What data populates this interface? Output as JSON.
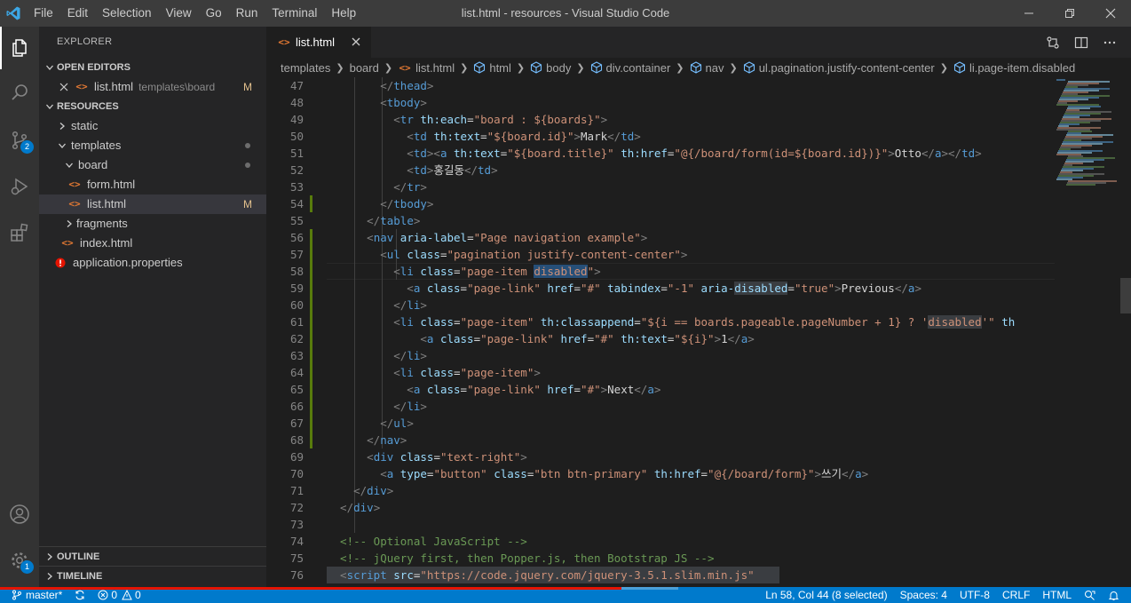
{
  "window": {
    "title": "list.html - resources - Visual Studio Code"
  },
  "menu": [
    "File",
    "Edit",
    "Selection",
    "View",
    "Go",
    "Run",
    "Terminal",
    "Help"
  ],
  "activity_bar": {
    "source_control_badge": "2",
    "settings_badge": "1"
  },
  "sidebar": {
    "title": "EXPLORER",
    "open_editors": {
      "header": "OPEN EDITORS",
      "items": [
        {
          "name": "list.html",
          "description": "templates\\board",
          "status": "M"
        }
      ]
    },
    "resources": {
      "header": "RESOURCES",
      "tree": [
        {
          "name": "static",
          "kind": "folder",
          "expanded": false
        },
        {
          "name": "templates",
          "kind": "folder",
          "expanded": true
        },
        {
          "name": "board",
          "kind": "folder",
          "expanded": true
        },
        {
          "name": "form.html",
          "kind": "html"
        },
        {
          "name": "list.html",
          "kind": "html",
          "status": "M"
        },
        {
          "name": "fragments",
          "kind": "folder",
          "expanded": false
        },
        {
          "name": "index.html",
          "kind": "html"
        },
        {
          "name": "application.properties",
          "kind": "properties"
        }
      ]
    },
    "outline": "OUTLINE",
    "timeline": "TIMELINE"
  },
  "tab": {
    "label": "list.html"
  },
  "breadcrumb": [
    "templates",
    "board",
    "list.html",
    "html",
    "body",
    "div.container",
    "nav",
    "ul.pagination.justify-content-center",
    "li.page-item.disabled"
  ],
  "code": {
    "line_numbers": [
      "47",
      "48",
      "49",
      "50",
      "51",
      "52",
      "53",
      "54",
      "55",
      "56",
      "57",
      "58",
      "59",
      "60",
      "61",
      "62",
      "63",
      "64",
      "65",
      "66",
      "67",
      "68",
      "69",
      "70",
      "71",
      "72",
      "73",
      "74",
      "75",
      "76"
    ],
    "lines": [
      [
        [
          "pu",
          "        </"
        ],
        [
          "tg",
          "thead"
        ],
        [
          "pu",
          ">"
        ]
      ],
      [
        [
          "pu",
          "        <"
        ],
        [
          "tg",
          "tbody"
        ],
        [
          "pu",
          ">"
        ]
      ],
      [
        [
          "pu",
          "          <"
        ],
        [
          "tg",
          "tr"
        ],
        [
          "tx",
          " "
        ],
        [
          "at",
          "th:each"
        ],
        [
          "tx",
          "="
        ],
        [
          "st",
          "\"board : ${boards}\""
        ],
        [
          "pu",
          ">"
        ]
      ],
      [
        [
          "pu",
          "            <"
        ],
        [
          "tg",
          "td"
        ],
        [
          "tx",
          " "
        ],
        [
          "at",
          "th:text"
        ],
        [
          "tx",
          "="
        ],
        [
          "st",
          "\"${board.id}\""
        ],
        [
          "pu",
          ">"
        ],
        [
          "tx",
          "Mark"
        ],
        [
          "pu",
          "</"
        ],
        [
          "tg",
          "td"
        ],
        [
          "pu",
          ">"
        ]
      ],
      [
        [
          "pu",
          "            <"
        ],
        [
          "tg",
          "td"
        ],
        [
          "pu",
          "><"
        ],
        [
          "tg",
          "a"
        ],
        [
          "tx",
          " "
        ],
        [
          "at",
          "th:text"
        ],
        [
          "tx",
          "="
        ],
        [
          "st",
          "\"${board.title}\""
        ],
        [
          "tx",
          " "
        ],
        [
          "at",
          "th:href"
        ],
        [
          "tx",
          "="
        ],
        [
          "st",
          "\"@{/board/form(id=${board.id})}\""
        ],
        [
          "pu",
          ">"
        ],
        [
          "tx",
          "Otto"
        ],
        [
          "pu",
          "</"
        ],
        [
          "tg",
          "a"
        ],
        [
          "pu",
          "></"
        ],
        [
          "tg",
          "td"
        ],
        [
          "pu",
          ">"
        ]
      ],
      [
        [
          "pu",
          "            <"
        ],
        [
          "tg",
          "td"
        ],
        [
          "pu",
          ">"
        ],
        [
          "tx",
          "홍길동"
        ],
        [
          "pu",
          "</"
        ],
        [
          "tg",
          "td"
        ],
        [
          "pu",
          ">"
        ]
      ],
      [
        [
          "pu",
          "          </"
        ],
        [
          "tg",
          "tr"
        ],
        [
          "pu",
          ">"
        ]
      ],
      [
        [
          "pu",
          "        </"
        ],
        [
          "tg",
          "tbody"
        ],
        [
          "pu",
          ">"
        ]
      ],
      [
        [
          "pu",
          "      </"
        ],
        [
          "tg",
          "table"
        ],
        [
          "pu",
          ">"
        ]
      ],
      [
        [
          "pu",
          "      <"
        ],
        [
          "tg",
          "nav"
        ],
        [
          "tx",
          " "
        ],
        [
          "at",
          "aria-label"
        ],
        [
          "tx",
          "="
        ],
        [
          "st",
          "\"Page navigation example\""
        ],
        [
          "pu",
          ">"
        ]
      ],
      [
        [
          "pu",
          "        <"
        ],
        [
          "tg",
          "ul"
        ],
        [
          "tx",
          " "
        ],
        [
          "at",
          "class"
        ],
        [
          "tx",
          "="
        ],
        [
          "st",
          "\"pagination justify-content-center\""
        ],
        [
          "pu",
          ">"
        ]
      ],
      [
        [
          "pu",
          "          <"
        ],
        [
          "tg",
          "li"
        ],
        [
          "tx",
          " "
        ],
        [
          "at",
          "class"
        ],
        [
          "tx",
          "="
        ],
        [
          "st",
          "\"page-item "
        ],
        [
          "st hl",
          "disabled"
        ],
        [
          "st",
          "\""
        ],
        [
          "pu",
          ">"
        ]
      ],
      [
        [
          "pu",
          "            <"
        ],
        [
          "tg",
          "a"
        ],
        [
          "tx",
          " "
        ],
        [
          "at",
          "class"
        ],
        [
          "tx",
          "="
        ],
        [
          "st",
          "\"page-link\""
        ],
        [
          "tx",
          " "
        ],
        [
          "at",
          "href"
        ],
        [
          "tx",
          "="
        ],
        [
          "st",
          "\"#\""
        ],
        [
          "tx",
          " "
        ],
        [
          "at",
          "tabindex"
        ],
        [
          "tx",
          "="
        ],
        [
          "st",
          "\"-1\""
        ],
        [
          "tx",
          " "
        ],
        [
          "at",
          "aria-"
        ],
        [
          "at hl2",
          "disabled"
        ],
        [
          "tx",
          "="
        ],
        [
          "st",
          "\"true\""
        ],
        [
          "pu",
          ">"
        ],
        [
          "tx",
          "Previous"
        ],
        [
          "pu",
          "</"
        ],
        [
          "tg",
          "a"
        ],
        [
          "pu",
          ">"
        ]
      ],
      [
        [
          "pu",
          "          </"
        ],
        [
          "tg",
          "li"
        ],
        [
          "pu",
          ">"
        ]
      ],
      [
        [
          "pu",
          "          <"
        ],
        [
          "tg",
          "li"
        ],
        [
          "tx",
          " "
        ],
        [
          "at",
          "class"
        ],
        [
          "tx",
          "="
        ],
        [
          "st",
          "\"page-item\""
        ],
        [
          "tx",
          " "
        ],
        [
          "at",
          "th:classappend"
        ],
        [
          "tx",
          "="
        ],
        [
          "st",
          "\"${i == boards.pageable.pageNumber + 1} ? '"
        ],
        [
          "st hl2",
          "disabled"
        ],
        [
          "st",
          "'\""
        ],
        [
          "tx",
          " "
        ],
        [
          "at",
          "th"
        ]
      ],
      [
        [
          "pu",
          "              <"
        ],
        [
          "tg",
          "a"
        ],
        [
          "tx",
          " "
        ],
        [
          "at",
          "class"
        ],
        [
          "tx",
          "="
        ],
        [
          "st",
          "\"page-link\""
        ],
        [
          "tx",
          " "
        ],
        [
          "at",
          "href"
        ],
        [
          "tx",
          "="
        ],
        [
          "st",
          "\"#\""
        ],
        [
          "tx",
          " "
        ],
        [
          "at",
          "th:text"
        ],
        [
          "tx",
          "="
        ],
        [
          "st",
          "\"${i}\""
        ],
        [
          "pu",
          ">"
        ],
        [
          "tx",
          "1"
        ],
        [
          "pu",
          "</"
        ],
        [
          "tg",
          "a"
        ],
        [
          "pu",
          ">"
        ]
      ],
      [
        [
          "pu",
          "          </"
        ],
        [
          "tg",
          "li"
        ],
        [
          "pu",
          ">"
        ]
      ],
      [
        [
          "pu",
          "          <"
        ],
        [
          "tg",
          "li"
        ],
        [
          "tx",
          " "
        ],
        [
          "at",
          "class"
        ],
        [
          "tx",
          "="
        ],
        [
          "st",
          "\"page-item\""
        ],
        [
          "pu",
          ">"
        ]
      ],
      [
        [
          "pu",
          "            <"
        ],
        [
          "tg",
          "a"
        ],
        [
          "tx",
          " "
        ],
        [
          "at",
          "class"
        ],
        [
          "tx",
          "="
        ],
        [
          "st",
          "\"page-link\""
        ],
        [
          "tx",
          " "
        ],
        [
          "at",
          "href"
        ],
        [
          "tx",
          "="
        ],
        [
          "st",
          "\"#\""
        ],
        [
          "pu",
          ">"
        ],
        [
          "tx",
          "Next"
        ],
        [
          "pu",
          "</"
        ],
        [
          "tg",
          "a"
        ],
        [
          "pu",
          ">"
        ]
      ],
      [
        [
          "pu",
          "          </"
        ],
        [
          "tg",
          "li"
        ],
        [
          "pu",
          ">"
        ]
      ],
      [
        [
          "pu",
          "        </"
        ],
        [
          "tg",
          "ul"
        ],
        [
          "pu",
          ">"
        ]
      ],
      [
        [
          "pu",
          "      </"
        ],
        [
          "tg",
          "nav"
        ],
        [
          "pu",
          ">"
        ]
      ],
      [
        [
          "pu",
          "      <"
        ],
        [
          "tg",
          "div"
        ],
        [
          "tx",
          " "
        ],
        [
          "at",
          "class"
        ],
        [
          "tx",
          "="
        ],
        [
          "st",
          "\"text-right\""
        ],
        [
          "pu",
          ">"
        ]
      ],
      [
        [
          "pu",
          "        <"
        ],
        [
          "tg",
          "a"
        ],
        [
          "tx",
          " "
        ],
        [
          "at",
          "type"
        ],
        [
          "tx",
          "="
        ],
        [
          "st",
          "\"button\""
        ],
        [
          "tx",
          " "
        ],
        [
          "at",
          "class"
        ],
        [
          "tx",
          "="
        ],
        [
          "st",
          "\"btn btn-primary\""
        ],
        [
          "tx",
          " "
        ],
        [
          "at",
          "th:href"
        ],
        [
          "tx",
          "="
        ],
        [
          "st",
          "\"@{/board/form}\""
        ],
        [
          "pu",
          ">"
        ],
        [
          "tx",
          "쓰기"
        ],
        [
          "pu",
          "</"
        ],
        [
          "tg",
          "a"
        ],
        [
          "pu",
          ">"
        ]
      ],
      [
        [
          "pu",
          "    </"
        ],
        [
          "tg",
          "div"
        ],
        [
          "pu",
          ">"
        ]
      ],
      [
        [
          "pu",
          "  </"
        ],
        [
          "tg",
          "div"
        ],
        [
          "pu",
          ">"
        ]
      ],
      [],
      [
        [
          "cm",
          "  <!-- Optional JavaScript -->"
        ]
      ],
      [
        [
          "cm",
          "  <!-- jQuery first, then Popper.js, then Bootstrap JS -->"
        ]
      ],
      [
        [
          "pu",
          "  <"
        ],
        [
          "tg",
          "script"
        ],
        [
          "tx",
          " "
        ],
        [
          "at",
          "src"
        ],
        [
          "tx",
          "="
        ],
        [
          "st",
          "\"https://code.jquery.com/jquery-3.5.1.slim.min.js\""
        ]
      ]
    ]
  },
  "status_bar": {
    "branch": "master*",
    "errors": "0",
    "warnings": "0",
    "cursor": "Ln 58, Col 44 (8 selected)",
    "spaces": "Spaces: 4",
    "encoding": "UTF-8",
    "eol": "CRLF",
    "language": "HTML"
  }
}
